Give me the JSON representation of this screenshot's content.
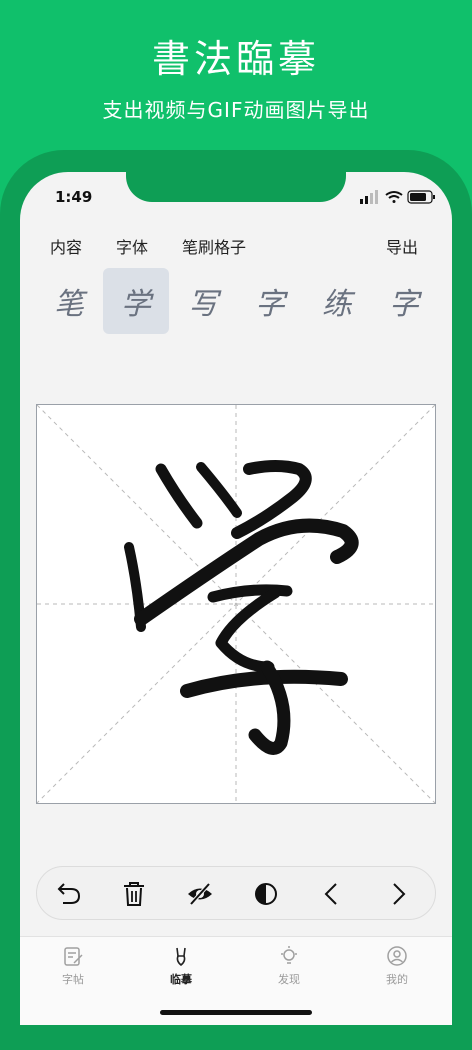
{
  "promo": {
    "title": "書法臨摹",
    "subtitle": "支出视频与GIF动画图片导出"
  },
  "status_bar": {
    "time": "1:49"
  },
  "menu": {
    "content": "内容",
    "font": "字体",
    "brush": "笔刷格子",
    "export": "导出"
  },
  "characters": [
    "笔",
    "学",
    "写",
    "字",
    "练",
    "字"
  ],
  "selected_character_index": 1,
  "canvas": {
    "glyph": "学",
    "grid_style": "米字格"
  },
  "toolbar": [
    "undo-icon",
    "trash-icon",
    "eye-off-icon",
    "contrast-icon",
    "chevron-left-icon",
    "chevron-right-icon"
  ],
  "tabs": [
    {
      "label": "字帖",
      "icon": "copybook-icon",
      "active": false
    },
    {
      "label": "临摹",
      "icon": "brush-icon",
      "active": true
    },
    {
      "label": "发现",
      "icon": "lightbulb-icon",
      "active": false
    },
    {
      "label": "我的",
      "icon": "profile-icon",
      "active": false
    }
  ],
  "colors": {
    "brand_green": "#10c06b",
    "frame_green": "#0e9e55",
    "selected_tab_bg": "#dbe0e7"
  }
}
